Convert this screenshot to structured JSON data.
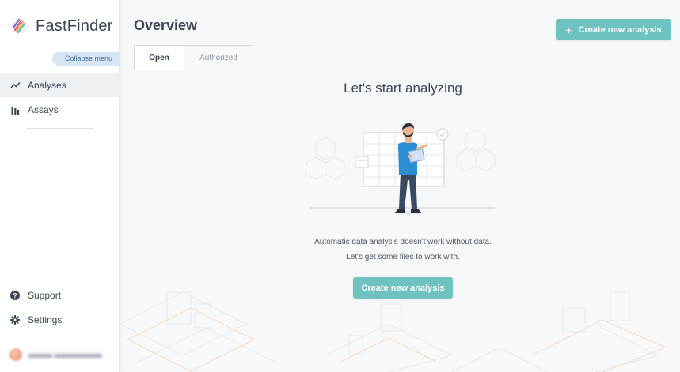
{
  "brand": {
    "name": "FastFinder"
  },
  "sidebar": {
    "collapse_label": "Collapse menu",
    "items": [
      {
        "label": "Analyses",
        "icon": "line-chart-icon",
        "active": true
      },
      {
        "label": "Assays",
        "icon": "bar-chart-icon",
        "active": false
      }
    ],
    "bottom_items": [
      {
        "label": "Support",
        "icon": "question-circle-icon"
      },
      {
        "label": "Settings",
        "icon": "gear-icon"
      }
    ]
  },
  "header": {
    "title": "Overview",
    "create_button": "Create new analysis",
    "create_icon": "+"
  },
  "tabs": [
    {
      "label": "Open",
      "active": true
    },
    {
      "label": "Authorized",
      "active": false
    }
  ],
  "empty_state": {
    "title": "Let's start analyzing",
    "message_line1": "Automatic data analysis doesn't work without data.",
    "message_line2": "Let's get some files to work with.",
    "button": "Create new analysis"
  },
  "colors": {
    "accent": "#6ec2c0",
    "collapse_bg": "#d6e6f5",
    "active_nav_bg": "#eef1f4"
  }
}
